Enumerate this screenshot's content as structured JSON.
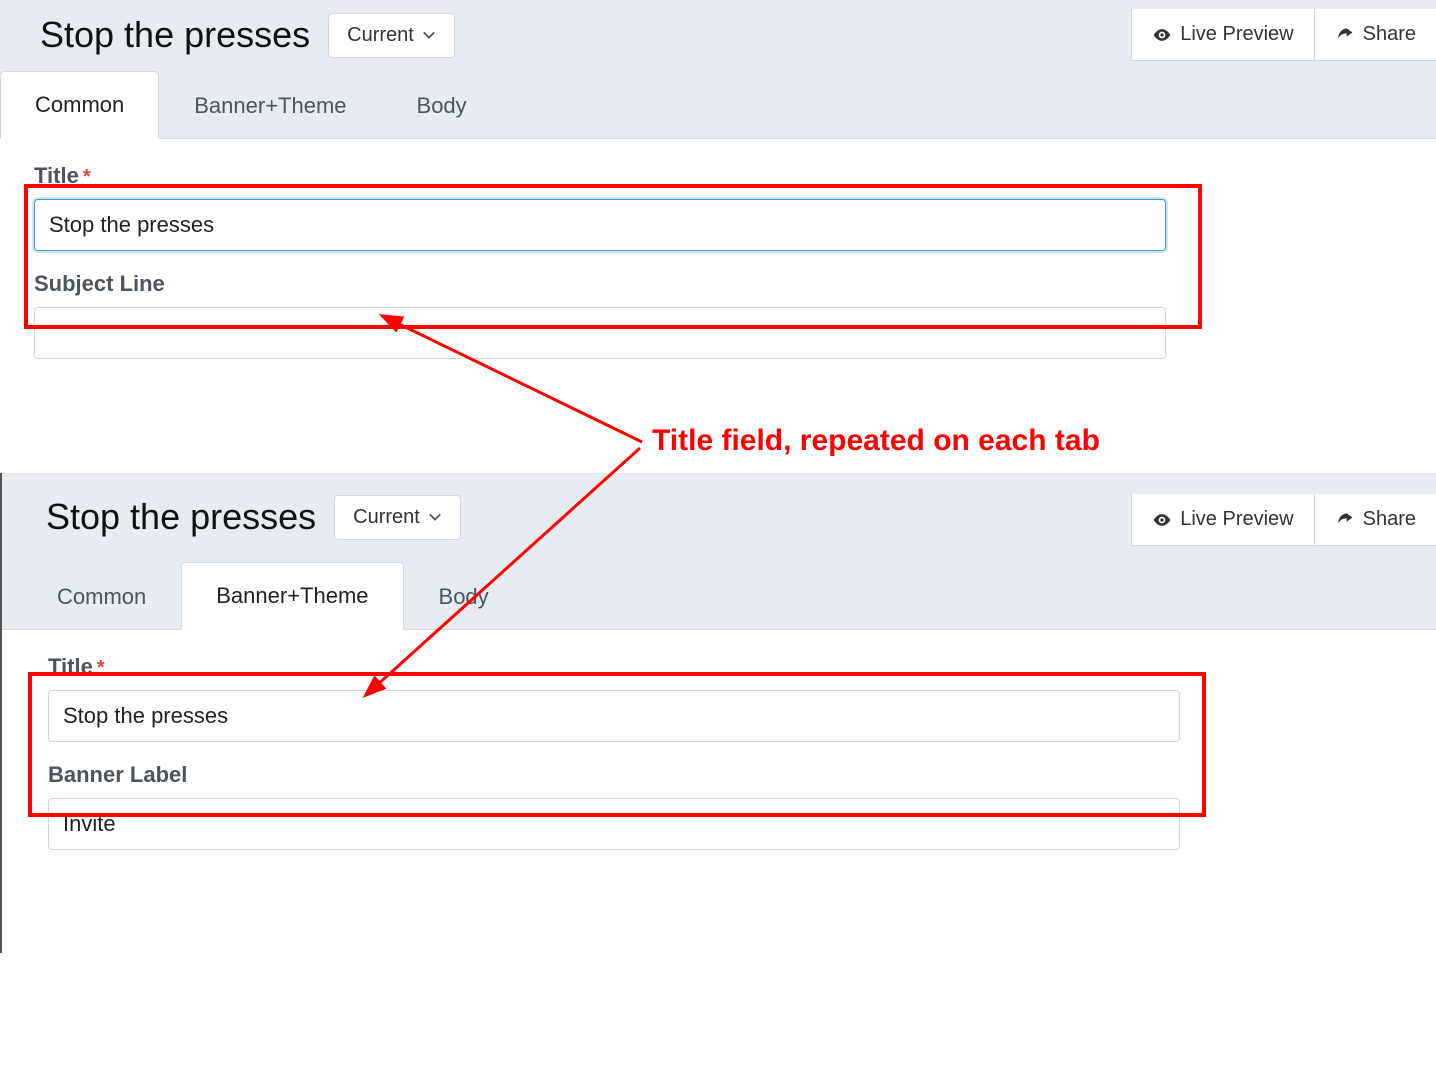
{
  "annotation": "Title field, repeated on each tab",
  "panel1": {
    "title": "Stop the presses",
    "version_button": "Current",
    "live_preview": "Live Preview",
    "share": "Share",
    "tabs": {
      "common": "Common",
      "banner": "Banner+Theme",
      "body": "Body"
    },
    "fields": {
      "title_label": "Title",
      "title_value": "Stop the presses",
      "subject_label": "Subject Line",
      "subject_value": ""
    }
  },
  "panel2": {
    "title": "Stop the presses",
    "version_button": "Current",
    "live_preview": "Live Preview",
    "share": "Share",
    "tabs": {
      "common": "Common",
      "banner": "Banner+Theme",
      "body": "Body"
    },
    "fields": {
      "title_label": "Title",
      "title_value": "Stop the presses",
      "banner_label": "Banner Label",
      "banner_value": "Invite"
    }
  }
}
